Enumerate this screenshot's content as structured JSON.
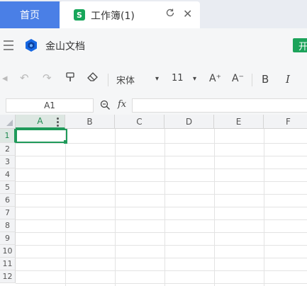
{
  "tabs": {
    "home_label": "首页",
    "doc_icon_letter": "S",
    "doc_title": "工作簿(1)",
    "refresh_glyph": "C",
    "close_glyph": "✕"
  },
  "app": {
    "name": "金山文档",
    "share_label": "开"
  },
  "toolbar": {
    "undo_glyph": "↶",
    "redo_glyph": "↷",
    "format_painter_glyph": "⎙",
    "eraser_glyph": "⌫",
    "font_name": "宋体",
    "font_size": "11",
    "dropdown_glyph": "▾",
    "increase_font": "A⁺",
    "decrease_font": "A⁻",
    "bold": "B",
    "italic": "I"
  },
  "formula_bar": {
    "cell_ref": "A1",
    "fx_label": "fx",
    "zoom_glyph": "⌕",
    "formula_value": ""
  },
  "sheet": {
    "columns": [
      "A",
      "B",
      "C",
      "D",
      "E",
      "F"
    ],
    "rows": [
      "1",
      "2",
      "3",
      "4",
      "5",
      "6",
      "7",
      "8",
      "9",
      "10",
      "11",
      "12"
    ],
    "selected_cell": "A1",
    "accent_color": "#1f9a5a"
  }
}
